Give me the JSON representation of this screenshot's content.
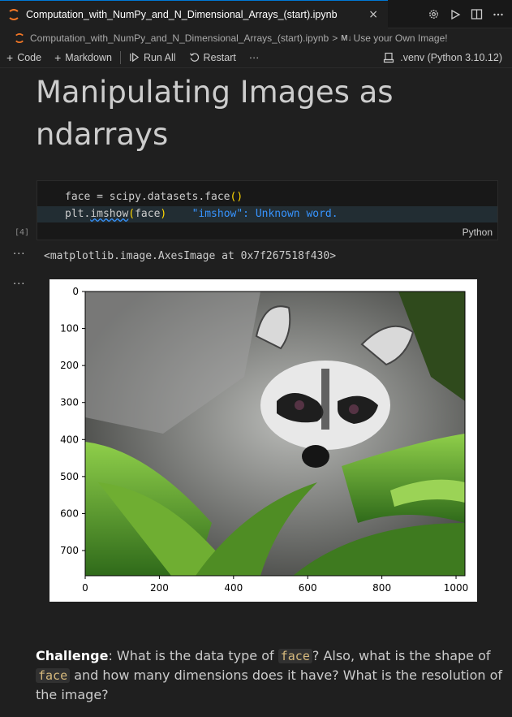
{
  "tab": {
    "title": "Computation_with_NumPy_and_N_Dimensional_Arrays_(start).ipynb",
    "close_icon": "×"
  },
  "breadcrumb": {
    "file": "Computation_with_NumPy_and_N_Dimensional_Arrays_(start).ipynb",
    "sep": ">",
    "md_badge": "M↓",
    "section": "Use your Own Image!"
  },
  "toolbar": {
    "code_label": "Code",
    "markdown_label": "Markdown",
    "run_all_label": "Run All",
    "restart_label": "Restart",
    "more_label": "···",
    "kernel_label": ".venv (Python 3.10.12)"
  },
  "heading": "Manipulating Images as ndarrays",
  "cell": {
    "line1_a": "face = scipy.datasets.face",
    "line1_b": "()",
    "line2_a": "plt.",
    "line2_b": "imshow",
    "line2_c": "(",
    "line2_d": "face",
    "line2_e": ")",
    "hint": "\"imshow\": Unknown word.",
    "language": "Python",
    "exec_count": "[4]"
  },
  "output": {
    "text": "<matplotlib.image.AxesImage at 0x7f267518f430>",
    "dots": "···"
  },
  "plot": {
    "y_ticks": [
      "0",
      "100",
      "200",
      "300",
      "400",
      "500",
      "600",
      "700"
    ],
    "x_ticks": [
      "0",
      "200",
      "400",
      "600",
      "800",
      "1000"
    ]
  },
  "markdown": {
    "bold": "Challenge",
    "t1": ": What is the data type of ",
    "c1": "face",
    "t2": "? Also, what is the shape of ",
    "c2": "face",
    "t3": " and how many dimensions does it have? What is the resolution of the image?"
  },
  "colors": {
    "accent": "#0078d4",
    "jupyter_orange": "#f37726"
  }
}
